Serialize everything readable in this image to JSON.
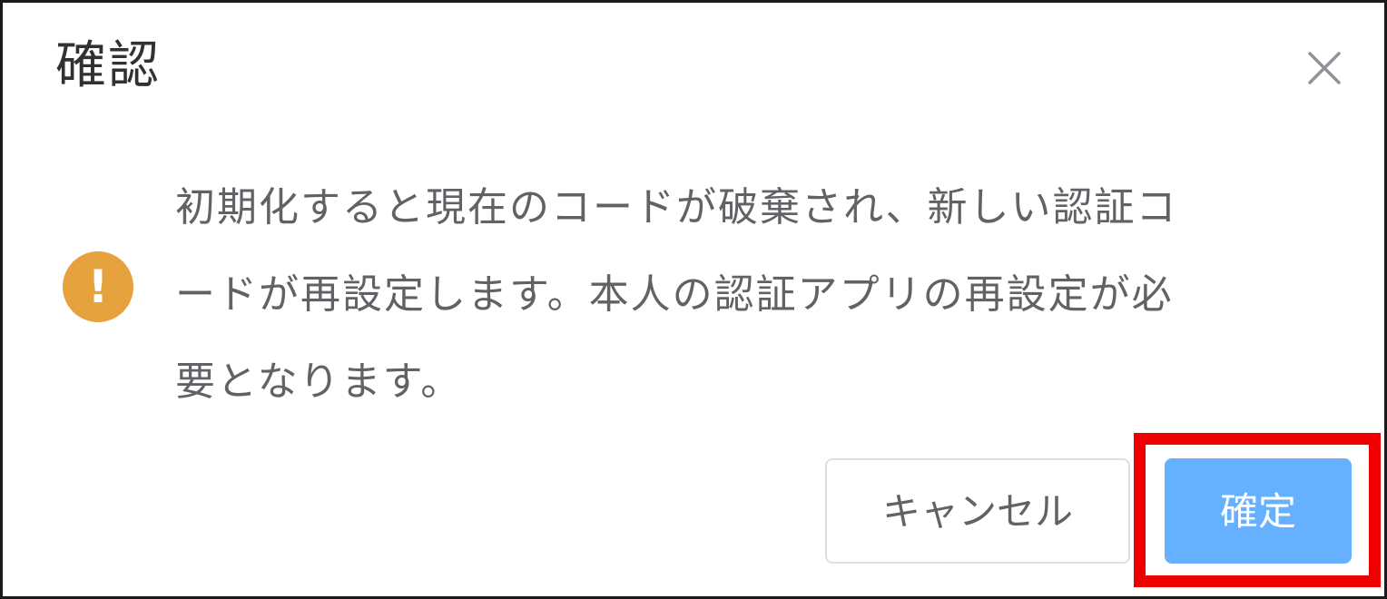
{
  "dialog": {
    "title": "確認",
    "close_icon": "close-icon",
    "message_lines": [
      "初期化すると現在のコードが破棄され、新しい認証コ",
      "ードが再設定します。本人の認証アプリの再設定が必",
      "要となります。"
    ],
    "warning_icon": "warning-icon",
    "warning_glyph": "!",
    "warning_color": "#e6a23c",
    "buttons": {
      "cancel_label": "キャンセル",
      "confirm_label": "確定"
    },
    "confirm_color": "#66b1ff",
    "highlight_color": "#ee0000"
  }
}
